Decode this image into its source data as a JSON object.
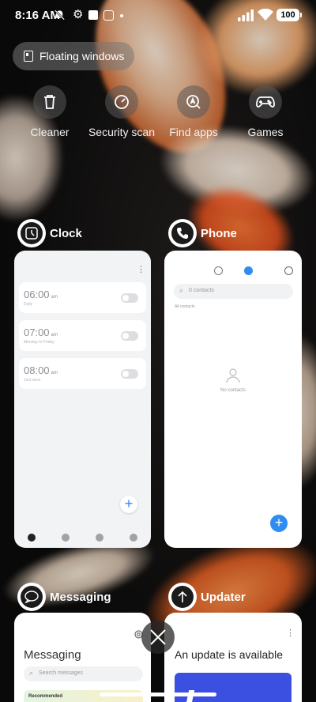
{
  "status_bar": {
    "time": "8:16 AM",
    "battery": "100"
  },
  "floating_windows": {
    "label": "Floating windows"
  },
  "quick_actions": [
    {
      "label": "Cleaner",
      "icon": "trash-icon"
    },
    {
      "label": "Security scan",
      "icon": "speedometer-icon"
    },
    {
      "label": "Find apps",
      "icon": "find-apps-icon"
    },
    {
      "label": "Games",
      "icon": "gamepad-icon"
    }
  ],
  "apps": {
    "clock": {
      "name": "Clock",
      "alarms": [
        {
          "time": "06:00",
          "period": "am",
          "note": "Daily"
        },
        {
          "time": "07:00",
          "period": "am",
          "note": "Monday to Friday"
        },
        {
          "time": "08:00",
          "period": "am",
          "note": "Just once"
        }
      ]
    },
    "phone": {
      "name": "Phone",
      "search_placeholder": "0 contacts",
      "all_contacts": "All contacts",
      "empty_text": "No contacts"
    },
    "messaging": {
      "name": "Messaging",
      "title": "Messaging",
      "search_placeholder": "Search messages",
      "recommended": "Recommended"
    },
    "updater": {
      "name": "Updater",
      "title": "An update is available"
    }
  },
  "colors": {
    "accent_blue": "#2f8cf0",
    "card_bg": "#f2f3f5",
    "updater_banner": "#3b4fe0"
  }
}
